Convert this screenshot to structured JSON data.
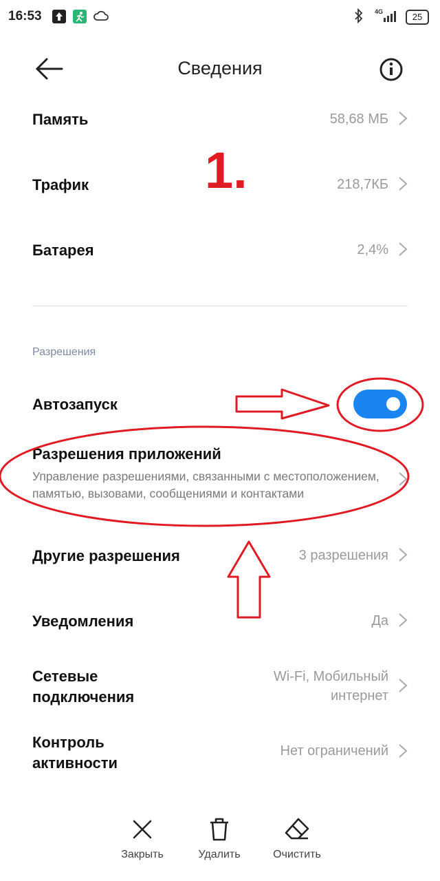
{
  "status_bar": {
    "time": "16:53",
    "battery": "25",
    "network": "4G"
  },
  "header": {
    "title": "Сведения"
  },
  "usage_rows": [
    {
      "label": "Память",
      "value": "58,68 МБ"
    },
    {
      "label": "Трафик",
      "value": "218,7КБ"
    },
    {
      "label": "Батарея",
      "value": "2,4%"
    }
  ],
  "annotation": {
    "step_number": "1."
  },
  "permissions": {
    "section_label": "Разрешения",
    "autostart": {
      "label": "Автозапуск",
      "enabled": true
    },
    "app_permissions": {
      "label": "Разрешения приложений",
      "description": "Управление разрешениями, связанными с местоположением, памятью, вызовами, сообщениями и контактами"
    },
    "other": {
      "label": "Другие разрешения",
      "value": "3 разрешения"
    },
    "notifications": {
      "label": "Уведомления",
      "value": "Да"
    },
    "network": {
      "label_line1": "Сетевые",
      "label_line2": "подключения",
      "value_line1": "Wi-Fi, Мобильный",
      "value_line2": "интернет"
    },
    "activity": {
      "label_line1": "Контроль",
      "label_line2": "активности",
      "value": "Нет ограничений"
    }
  },
  "bottom_bar": {
    "close": "Закрыть",
    "delete": "Удалить",
    "clear": "Очистить"
  },
  "colors": {
    "accent": "#1a84f0",
    "annotation": "#e01b24"
  }
}
